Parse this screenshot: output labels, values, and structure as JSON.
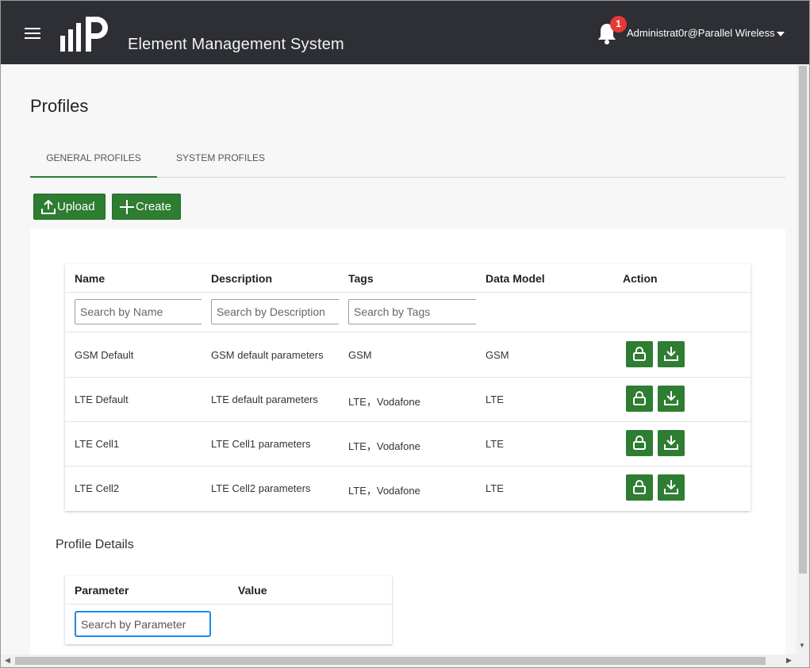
{
  "header": {
    "app_title": "Element Management System",
    "notification_count": "1",
    "user": "Administrat0r@Parallel Wireless"
  },
  "page": {
    "title": "Profiles",
    "tabs": [
      {
        "label": "GENERAL PROFILES",
        "active": true
      },
      {
        "label": "SYSTEM PROFILES",
        "active": false
      }
    ],
    "buttons": {
      "upload": "Upload",
      "create": "Create"
    }
  },
  "profiles_table": {
    "columns": [
      "Name",
      "Description",
      "Tags",
      "Data Model",
      "Action"
    ],
    "filters": {
      "name": "Search by Name",
      "description": "Search by Description",
      "tags": "Search by Tags"
    },
    "rows": [
      {
        "name": "GSM Default",
        "description": "GSM default parameters",
        "tags": "GSM",
        "data_model": "GSM"
      },
      {
        "name": "LTE Default",
        "description": "LTE default parameters",
        "tags": "LTE，Vodafone",
        "data_model": "LTE"
      },
      {
        "name": "LTE Cell1",
        "description": "LTE Cell1 parameters",
        "tags": "LTE，Vodafone",
        "data_model": "LTE"
      },
      {
        "name": "LTE Cell2",
        "description": "LTE Cell2 parameters",
        "tags": "LTE，Vodafone",
        "data_model": "LTE"
      }
    ],
    "row_actions": [
      "lock-icon",
      "download-icon"
    ]
  },
  "profile_details": {
    "title": "Profile Details",
    "columns": [
      "Parameter",
      "Value"
    ],
    "filter_placeholder": "Search by Parameter"
  },
  "colors": {
    "topbar": "#2d2f34",
    "accent_green": "#2e7d32",
    "badge_red": "#e53935",
    "focus_blue": "#1e88e5"
  }
}
